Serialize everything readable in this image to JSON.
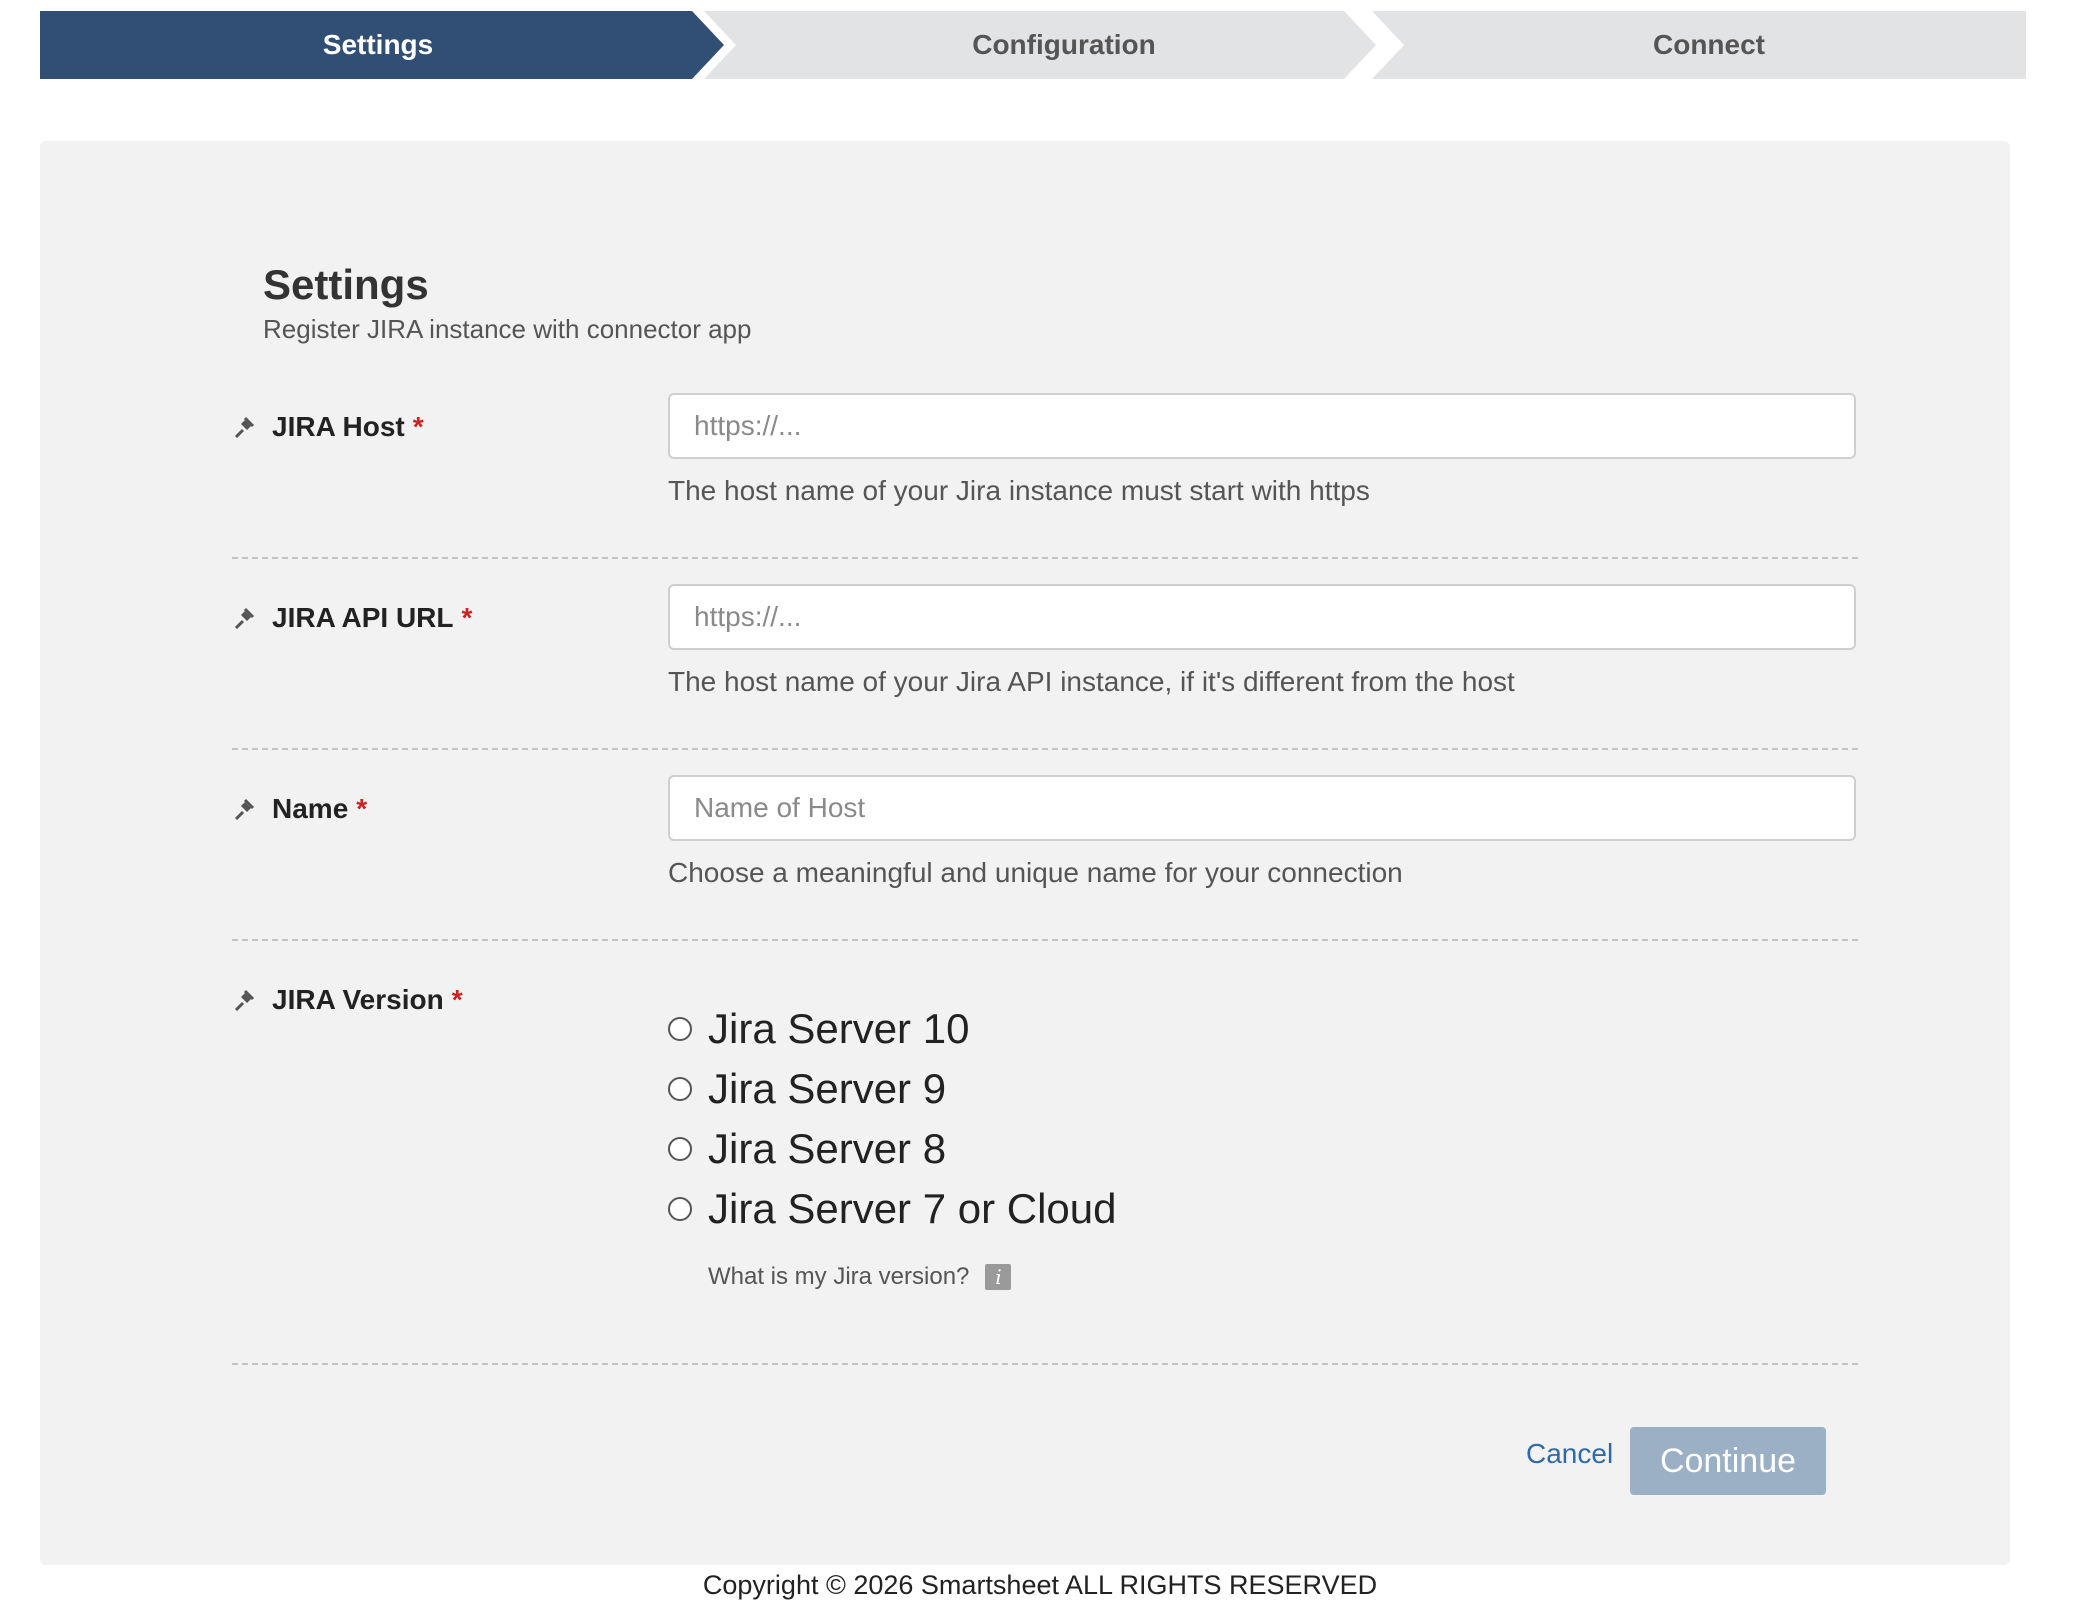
{
  "stepper": {
    "steps": [
      {
        "label": "Settings",
        "active": true
      },
      {
        "label": "Configuration",
        "active": false
      },
      {
        "label": "Connect",
        "active": false
      }
    ],
    "active_color": "#314f75",
    "inactive_color": "#e2e3e5"
  },
  "form": {
    "title": "Settings",
    "subtitle": "Register JIRA instance with connector app",
    "required_marker": "*",
    "fields": [
      {
        "label": "JIRA Host",
        "placeholder": "https://...",
        "value": "",
        "help": "The host name of your Jira instance must start with https",
        "icon": "pin-icon"
      },
      {
        "label": "JIRA API URL",
        "placeholder": "https://...",
        "value": "",
        "help": "The host name of your Jira API instance, if it's different from the host",
        "icon": "pin-icon"
      },
      {
        "label": "Name",
        "placeholder": "Name of Host",
        "value": "",
        "help": "Choose a meaningful and unique name for your connection",
        "icon": "pin-icon"
      }
    ],
    "version": {
      "label": "JIRA Version",
      "icon": "pin-icon",
      "options": [
        "Jira Server 10",
        "Jira Server 9",
        "Jira Server 8",
        "Jira Server 7 or Cloud"
      ],
      "selected": null,
      "hint": "What is my Jira version?",
      "hint_icon": "info-icon",
      "hint_icon_glyph": "i"
    },
    "cancel_label": "Cancel",
    "continue_label": "Continue",
    "link_color": "#2f6aa7",
    "button_color": "#9bb0c5"
  },
  "footer": {
    "copyright": "Copyright © 2026 Smartsheet ALL RIGHTS RESERVED"
  }
}
